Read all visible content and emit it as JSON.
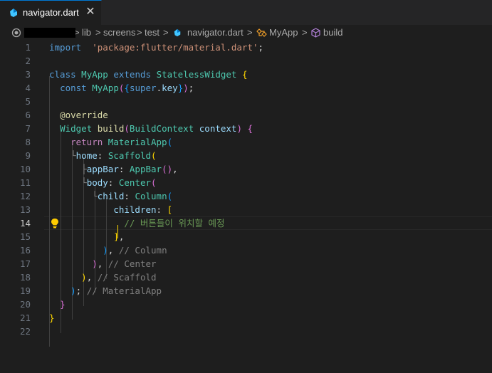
{
  "tab": {
    "filename": "navigator.dart",
    "close_glyph": "✕",
    "icon": "dart-icon"
  },
  "breadcrumb": {
    "items": [
      "lib",
      "screens",
      "test",
      "navigator.dart",
      "MyApp",
      "build"
    ],
    "separator": ">"
  },
  "editor": {
    "active_line": 14,
    "lines": [
      {
        "n": "1",
        "tokens": [
          [
            "kw",
            "import"
          ],
          [
            "",
            "  "
          ],
          [
            "str",
            "'package:flutter/material.dart'"
          ],
          [
            "",
            ";"
          ]
        ]
      },
      {
        "n": "2",
        "tokens": []
      },
      {
        "n": "3",
        "tokens": [
          [
            "kw",
            "class"
          ],
          [
            "",
            " "
          ],
          [
            "cls",
            "MyApp"
          ],
          [
            "",
            " "
          ],
          [
            "kw",
            "extends"
          ],
          [
            "",
            " "
          ],
          [
            "cls",
            "StatelessWidget"
          ],
          [
            "",
            " "
          ],
          [
            "b1",
            "{"
          ]
        ]
      },
      {
        "n": "4",
        "tokens": [
          [
            "",
            "  "
          ],
          [
            "kw",
            "const"
          ],
          [
            "",
            " "
          ],
          [
            "cls",
            "MyApp"
          ],
          [
            "b2",
            "("
          ],
          [
            "b3",
            "{"
          ],
          [
            "kw",
            "super"
          ],
          [
            "",
            "."
          ],
          [
            "prm",
            "key"
          ],
          [
            "b3",
            "}"
          ],
          [
            "b2",
            ")"
          ],
          [
            "",
            ";"
          ]
        ]
      },
      {
        "n": "5",
        "tokens": []
      },
      {
        "n": "6",
        "tokens": [
          [
            "",
            "  "
          ],
          [
            "ann",
            "@override"
          ]
        ]
      },
      {
        "n": "7",
        "tokens": [
          [
            "",
            "  "
          ],
          [
            "cls",
            "Widget"
          ],
          [
            "",
            " "
          ],
          [
            "fn",
            "build"
          ],
          [
            "b2",
            "("
          ],
          [
            "cls",
            "BuildContext"
          ],
          [
            "",
            " "
          ],
          [
            "prm",
            "context"
          ],
          [
            "b2",
            ")"
          ],
          [
            "",
            " "
          ],
          [
            "b2",
            "{"
          ]
        ]
      },
      {
        "n": "8",
        "tokens": [
          [
            "",
            "    "
          ],
          [
            "ctl",
            "return"
          ],
          [
            "",
            " "
          ],
          [
            "cls",
            "MaterialApp"
          ],
          [
            "b3",
            "("
          ]
        ]
      },
      {
        "n": "9",
        "tokens": [
          [
            "gy",
            "    └"
          ],
          [
            "prm",
            "home"
          ],
          [
            "",
            ": "
          ],
          [
            "cls",
            "Scaffold"
          ],
          [
            "b1",
            "("
          ]
        ]
      },
      {
        "n": "10",
        "tokens": [
          [
            "gy",
            "      ├"
          ],
          [
            "prm",
            "appBar"
          ],
          [
            "",
            ": "
          ],
          [
            "cls",
            "AppBar"
          ],
          [
            "b2",
            "()"
          ],
          [
            "",
            ","
          ]
        ]
      },
      {
        "n": "11",
        "tokens": [
          [
            "gy",
            "      └"
          ],
          [
            "prm",
            "body"
          ],
          [
            "",
            ": "
          ],
          [
            "cls",
            "Center"
          ],
          [
            "b2",
            "("
          ]
        ]
      },
      {
        "n": "12",
        "tokens": [
          [
            "gy",
            "        └"
          ],
          [
            "prm",
            "child"
          ],
          [
            "",
            ": "
          ],
          [
            "cls",
            "Column"
          ],
          [
            "b3",
            "("
          ]
        ]
      },
      {
        "n": "13",
        "tokens": [
          [
            "",
            "            "
          ],
          [
            "prm",
            "children"
          ],
          [
            "",
            ": "
          ],
          [
            "b1",
            "["
          ]
        ]
      },
      {
        "n": "14",
        "tokens": [
          [
            "",
            "              "
          ],
          [
            "cm",
            "// 버튼들이 위치할 예정"
          ]
        ]
      },
      {
        "n": "15",
        "tokens": [
          [
            "",
            "            "
          ],
          [
            "b1",
            "]"
          ],
          [
            "",
            ","
          ]
        ]
      },
      {
        "n": "16",
        "tokens": [
          [
            "",
            "          "
          ],
          [
            "b3",
            ")"
          ],
          [
            "",
            ", "
          ],
          [
            "gy",
            "// Column"
          ]
        ]
      },
      {
        "n": "17",
        "tokens": [
          [
            "",
            "        "
          ],
          [
            "b2",
            ")"
          ],
          [
            "",
            ", "
          ],
          [
            "gy",
            "// Center"
          ]
        ]
      },
      {
        "n": "18",
        "tokens": [
          [
            "",
            "      "
          ],
          [
            "b1",
            ")"
          ],
          [
            "",
            ", "
          ],
          [
            "gy",
            "// Scaffold"
          ]
        ]
      },
      {
        "n": "19",
        "tokens": [
          [
            "",
            "    "
          ],
          [
            "b3",
            ")"
          ],
          [
            "",
            "; "
          ],
          [
            "gy",
            "// MaterialApp"
          ]
        ]
      },
      {
        "n": "20",
        "tokens": [
          [
            "",
            "  "
          ],
          [
            "b2",
            "}"
          ]
        ]
      },
      {
        "n": "21",
        "tokens": [
          [
            "b1",
            "}"
          ]
        ]
      },
      {
        "n": "22",
        "tokens": []
      }
    ]
  },
  "colors": {
    "background": "#1e1e1e",
    "keyword": "#569cd6",
    "class": "#4ec9b0",
    "string": "#ce9178",
    "comment": "#6a9955"
  }
}
